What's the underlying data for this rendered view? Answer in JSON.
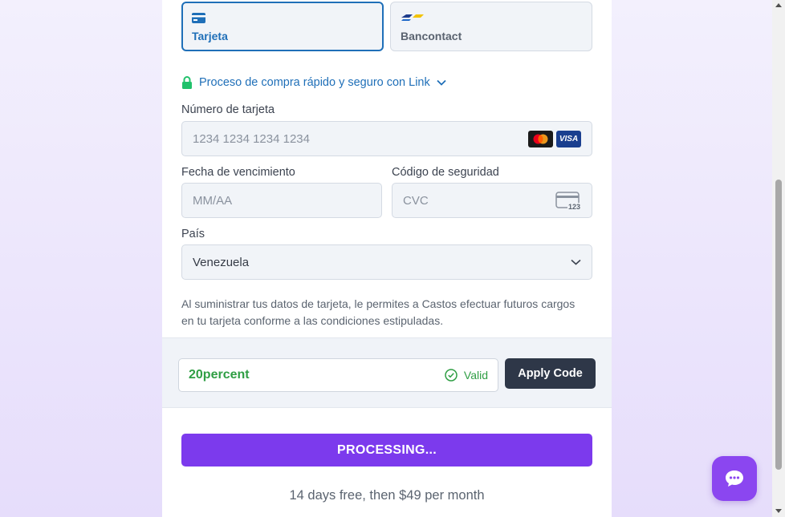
{
  "payment_methods": [
    {
      "label": "Tarjeta",
      "selected": true,
      "icon": "card-icon"
    },
    {
      "label": "Bancontact",
      "selected": false,
      "icon": "bancontact-logo"
    }
  ],
  "link": {
    "text": "Proceso de compra rápido y seguro con Link",
    "icon": "lock-icon"
  },
  "card_number": {
    "label": "Número de tarjeta",
    "placeholder": "1234 1234 1234 1234",
    "brands": [
      "mastercard-logo",
      "VISA"
    ]
  },
  "expiry": {
    "label": "Fecha de vencimiento",
    "placeholder": "MM/AA"
  },
  "cvc": {
    "label": "Código de seguridad",
    "placeholder": "CVC",
    "icon_text": "123"
  },
  "country": {
    "label": "País",
    "value": "Venezuela"
  },
  "consent": "Al suministrar tus datos de tarjeta, le permites a Castos efectuar futuros cargos en tu tarjeta conforme a las condiciones estipuladas.",
  "promo": {
    "code": "20percent",
    "status": "Valid",
    "apply_label": "Apply Code"
  },
  "submit_label": "PROCESSING...",
  "trial_text": "14 days free, then $49 per month",
  "colors": {
    "accent": "#7c3aed",
    "link": "#1f6fb8",
    "valid": "#2f9e44",
    "dark_button": "#2e3748"
  }
}
